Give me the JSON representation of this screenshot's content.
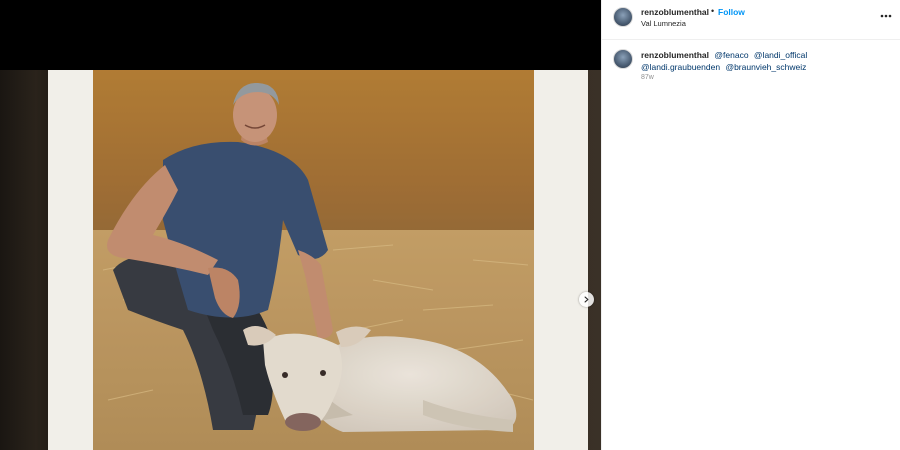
{
  "post": {
    "username": "renzoblumenthal",
    "separator": "•",
    "follow_label": "Follow",
    "location": "Val Lumnezia",
    "more_icon": "more-horizontal-icon"
  },
  "caption": {
    "username": "renzoblumenthal",
    "mentions": [
      "@fenaco",
      "@landi_offical",
      "@landi.graubuenden",
      "@braunvieh_schweiz"
    ],
    "age": "87w"
  },
  "media": {
    "image_alt": "photo",
    "next_icon": "chevron-right-icon"
  }
}
